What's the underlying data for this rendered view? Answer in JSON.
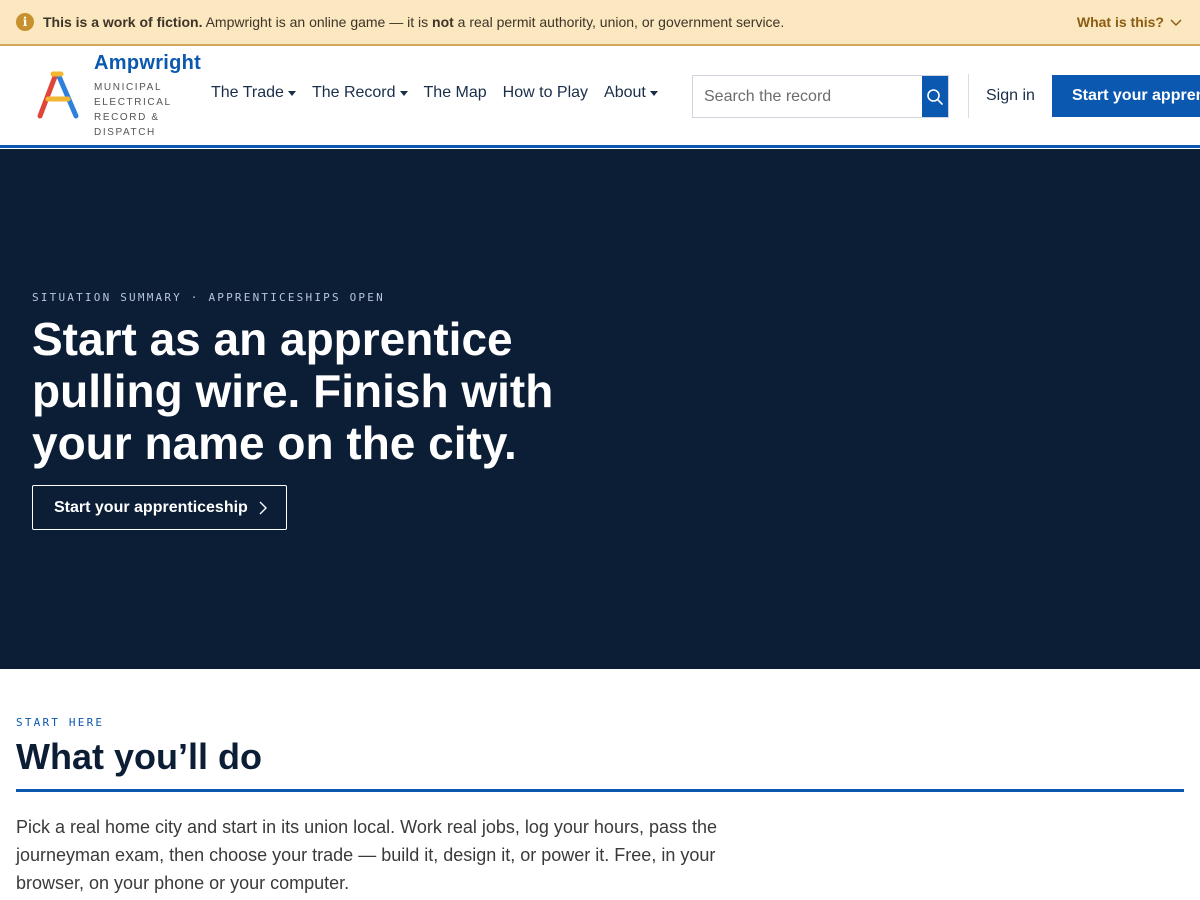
{
  "banner": {
    "lead": "This is a work of fiction.",
    "text_before": " Ampwright is an online game — it is ",
    "emphasis": "not",
    "text_after": " a real permit authority, union, or government service.",
    "link": "What is this?",
    "icon": "info-icon",
    "accent": "#c7922e"
  },
  "header": {
    "brand": "Ampwright",
    "tagline": "MUNICIPAL ELECTRICAL RECORD & DISPATCH",
    "nav": [
      {
        "label": "The Trade",
        "dropdown": true
      },
      {
        "label": "The Record",
        "dropdown": true
      },
      {
        "label": "The Map",
        "dropdown": false
      },
      {
        "label": "How to Play",
        "dropdown": false
      },
      {
        "label": "About",
        "dropdown": true
      }
    ],
    "search_placeholder": "Search the record",
    "sign_in": "Sign in",
    "cta": "Start your apprenticeship",
    "brand_color": "#0b58b0"
  },
  "hero": {
    "eyebrow": "SITUATION SUMMARY · APPRENTICESHIPS OPEN",
    "title": "Start as an apprentice pulling wire. Finish with your name on the city.",
    "button": "Start your apprenticeship",
    "background": "#0c1d36"
  },
  "start_here": {
    "eyebrow": "START HERE",
    "title": "What you’ll do",
    "body": "Pick a real home city and start in its union local. Work real jobs, log your hours, pass the journeyman exam, then choose your trade — build it, design it, or power it. Free, in your browser, on your phone or your computer."
  }
}
